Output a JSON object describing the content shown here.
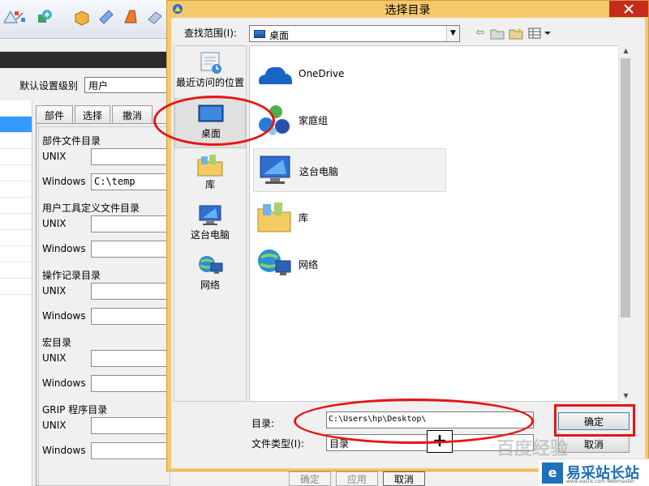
{
  "background_app": {
    "level_label": "默认设置级别",
    "level_value": "用户",
    "tabs": [
      "部件",
      "选择",
      "撤消"
    ],
    "sections": [
      {
        "title": "部件文件目录",
        "rows": [
          {
            "label": "UNIX",
            "value": ""
          },
          {
            "label": "Windows",
            "value": "C:\\temp"
          }
        ]
      },
      {
        "title": "用户工具定义文件目录",
        "rows": [
          {
            "label": "UNIX",
            "value": ""
          },
          {
            "label": "Windows",
            "value": ""
          }
        ]
      },
      {
        "title": "操作记录目录",
        "rows": [
          {
            "label": "UNIX",
            "value": ""
          },
          {
            "label": "Windows",
            "value": ""
          }
        ]
      },
      {
        "title": "宏目录",
        "rows": [
          {
            "label": "UNIX",
            "value": ""
          },
          {
            "label": "Windows",
            "value": ""
          }
        ]
      },
      {
        "title": "GRIP 程序目录",
        "rows": [
          {
            "label": "UNIX",
            "value": ""
          },
          {
            "label": "Windows",
            "value": ""
          }
        ]
      }
    ],
    "bottom_buttons": [
      "确定",
      "应用",
      "取消"
    ]
  },
  "dialog": {
    "title": "选择目录",
    "look_in_label": "查找范围(I):",
    "look_in_value": "桌面",
    "places": [
      "最近访问的位置",
      "桌面",
      "库",
      "这台电脑",
      "网络"
    ],
    "files": [
      "OneDrive",
      "家庭组",
      "这台电脑",
      "库",
      "网络"
    ],
    "dir_label": "目录:",
    "dir_value": "C:\\Users\\hp\\Desktop\\",
    "file_type_label": "文件类型(I):",
    "file_type_value": "目录",
    "ok_label": "确定",
    "cancel_label": "取消"
  },
  "watermark": {
    "site_name": "易采站长站",
    "url": "www.easck.com  Webmaster",
    "overlay": "百度经验"
  },
  "colors": {
    "dialog_frame": "#f6c96d",
    "annotation_red": "#e81414",
    "selection_blue": "#3399ff",
    "watermark_blue": "#1f6fb9"
  }
}
